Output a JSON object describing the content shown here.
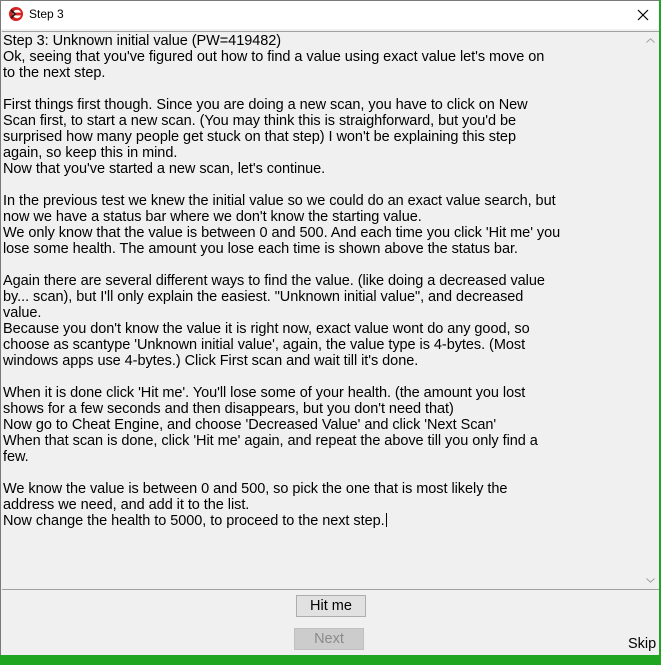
{
  "window": {
    "title": "Step 3",
    "accent_color": "#1fa51f"
  },
  "tutorial": {
    "paragraphs": [
      [
        "Step 3: Unknown initial value (PW=419482)",
        "Ok, seeing that you've figured out how to find a value using exact value let's move on",
        "to the next step."
      ],
      [
        "First things first though. Since you are doing a new scan, you have to click on New",
        "Scan first, to start a new scan. (You may think this is straighforward, but you'd be",
        "surprised how many people get stuck on that step) I won't be explaining this step",
        "again, so keep this in mind.",
        "Now that you've started a new scan, let's continue."
      ],
      [
        "In the previous test we knew the initial value so we could do an exact value search, but",
        "now we have a status bar where we don't know the starting value.",
        "We only know that the value is between 0 and 500. And each time you click 'Hit me' you",
        "lose some health. The amount you lose each time is shown above the status bar."
      ],
      [
        "Again there are several different ways to find the value. (like doing a decreased value",
        "by... scan), but I'll only explain the easiest. \"Unknown initial value\", and decreased",
        "value.",
        "Because you don't know the value it is right now, exact value wont do any good, so",
        "choose as scantype 'Unknown initial value', again, the value type is 4-bytes. (Most",
        "windows apps use 4-bytes.) Click First scan and wait till it's done."
      ],
      [
        "When it is done click 'Hit me'. You'll lose some of your health. (the amount you lost",
        "shows for a few seconds and then disappears, but you don't need that)",
        "Now go to Cheat Engine, and choose 'Decreased Value' and click 'Next Scan'",
        "When that scan is done, click 'Hit me' again, and repeat the above till you only find a",
        "few."
      ],
      [
        "We know the value is between 0 and 500, so pick the one that is most likely the",
        "address we need, and add it to the list.",
        "Now change the health to 5000, to proceed to the next step."
      ]
    ]
  },
  "buttons": {
    "hit_me": "Hit me",
    "next": "Next",
    "skip": "Skip"
  }
}
